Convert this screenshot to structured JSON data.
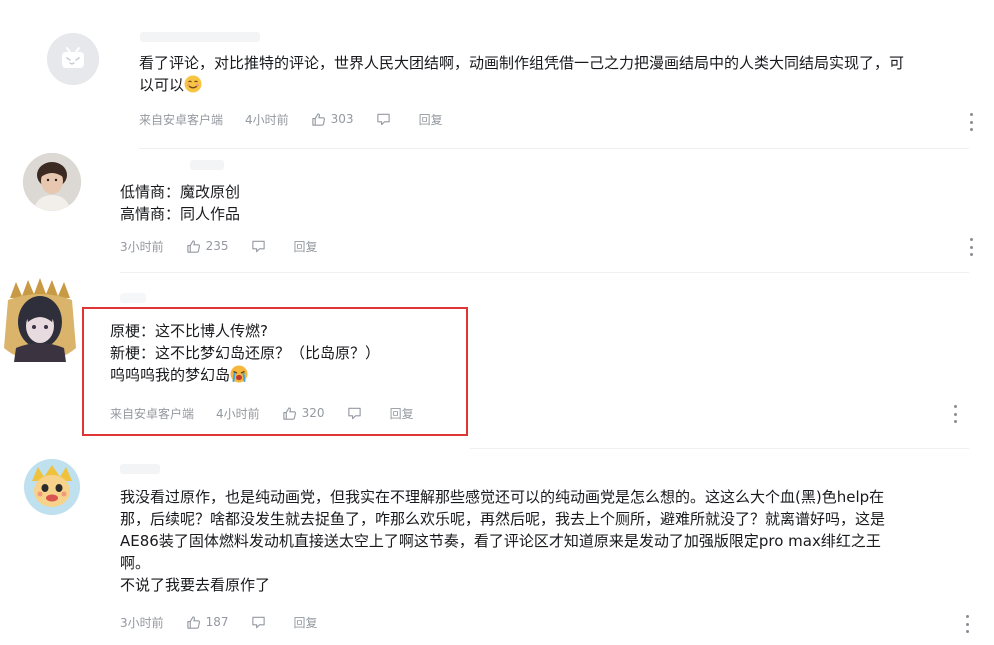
{
  "comments": [
    {
      "lines": [
        "看了评论，对比推特的评论，世界人民大团结啊，动画制作组凭借一己之力把漫画结局中的人类大同结局实现了，可",
        "以可以"
      ],
      "emoji": "smile-emoji",
      "source": "来自安卓客户端",
      "time": "4小时前",
      "likes": "303",
      "reply": "回复"
    },
    {
      "lines": [
        "低情商：魔改原创",
        "高情商：同人作品"
      ],
      "source": "",
      "time": "3小时前",
      "likes": "235",
      "reply": "回复"
    },
    {
      "lines": [
        "原梗：这不比博人传燃?",
        "新梗：这不比梦幻岛还原？（比岛原？）",
        "呜呜呜我的梦幻岛"
      ],
      "emoji": "crying-emoji",
      "source": "来自安卓客户端",
      "time": "4小时前",
      "likes": "320",
      "reply": "回复"
    },
    {
      "lines": [
        "我没看过原作，也是纯动画党，但我实在不理解那些感觉还可以的纯动画党是怎么想的。这这么大个血(黑)色help在",
        "那，后续呢？啥都没发生就去捉鱼了，咋那么欢乐呢，再然后呢，我去上个厕所，避难所就没了？就离谱好吗，这是",
        "AE86装了固体燃料发动机直接送太空上了啊这节奏，看了评论区才知道原来是发动了加强版限定pro max绯红之王",
        "啊。",
        "不说了我要去看原作了"
      ],
      "source": "",
      "time": "3小时前",
      "likes": "187",
      "reply": "回复"
    }
  ],
  "colors": {
    "highlight": "#e03535",
    "meta": "#9499a0",
    "text": "#18191c"
  }
}
